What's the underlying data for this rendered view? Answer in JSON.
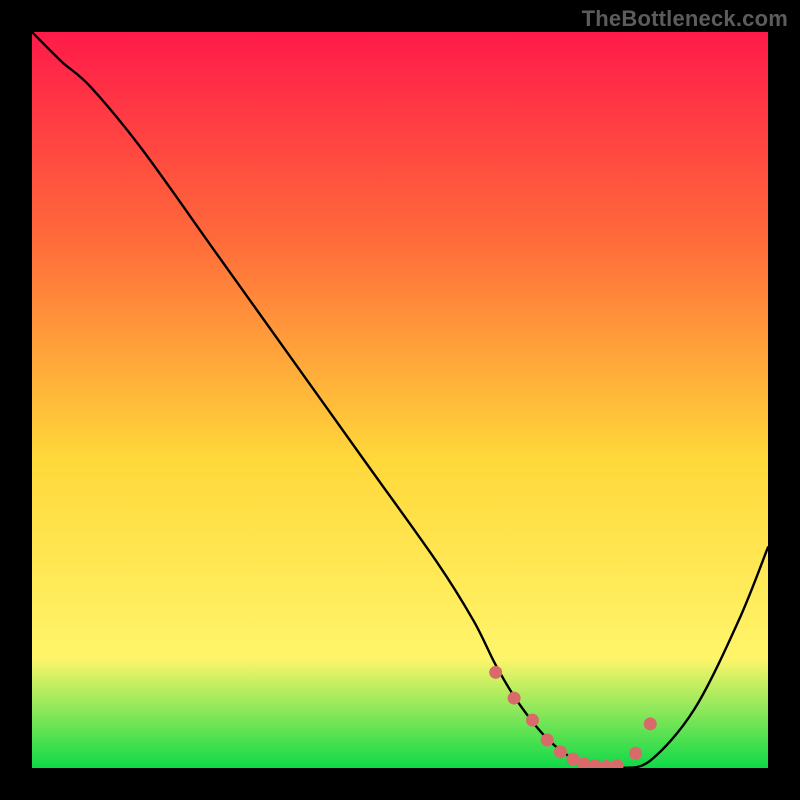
{
  "watermark": "TheBottleneck.com",
  "colors": {
    "page_bg": "#000000",
    "gradient_top": "#ff1a4a",
    "gradient_mid1": "#ff6a3a",
    "gradient_mid2": "#ffd83a",
    "gradient_mid3": "#fff56a",
    "gradient_bottom": "#0fd948",
    "curve": "#000000",
    "marker": "#d86a6a"
  },
  "chart_data": {
    "type": "line",
    "title": "",
    "xlabel": "",
    "ylabel": "",
    "xlim": [
      0,
      100
    ],
    "ylim": [
      0,
      100
    ],
    "series": [
      {
        "name": "bottleneck-curve",
        "x": [
          0,
          4,
          8,
          15,
          25,
          35,
          45,
          55,
          60,
          63,
          66,
          70,
          74,
          78,
          80,
          84,
          90,
          96,
          100
        ],
        "y": [
          100,
          96,
          92.5,
          84,
          70,
          56,
          42,
          28,
          20,
          14,
          9,
          4,
          1,
          0,
          0,
          1,
          8,
          20,
          30
        ]
      }
    ],
    "markers": {
      "name": "optimal-range",
      "x": [
        63,
        65.5,
        68,
        70,
        71.8,
        73.5,
        75,
        76.5,
        78,
        79.5,
        82,
        84
      ],
      "y": [
        13,
        9.5,
        6.5,
        3.8,
        2.2,
        1.2,
        0.6,
        0.3,
        0.2,
        0.3,
        2,
        6
      ]
    }
  }
}
